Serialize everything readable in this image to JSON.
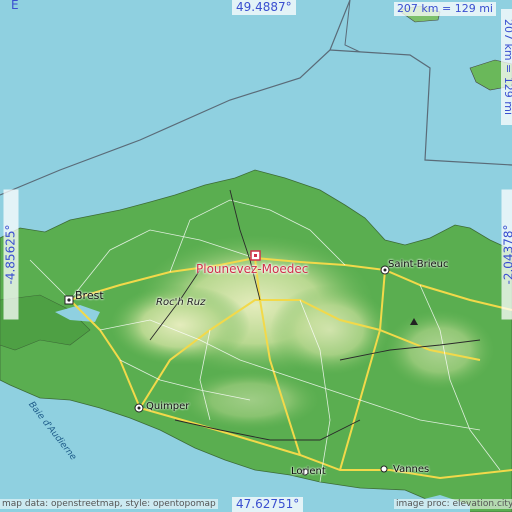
{
  "map": {
    "place_name": "Plounevez-Moedec",
    "coordinates": {
      "top_latitude": "49.4887°",
      "bottom_latitude": "47.62751°",
      "left_longitude": "-4.85625°",
      "right_longitude": "-2.04378°"
    },
    "scale": {
      "horizontal": "207 km = 129 mi",
      "vertical": "207 km = 129 mi"
    },
    "compass_label": "E",
    "places": {
      "brest": "Brest",
      "quimper": "Quimper",
      "saint_brieuc": "Saint-Brieuc",
      "lorient": "Lorient",
      "vannes": "Vannes",
      "roc_h_ruz": "Roc'h Ruz",
      "bay": "Baie d'Audierne"
    },
    "credits": {
      "left": "map data: openstreetmap, style: opentopomap",
      "right": "image proc: elevation.city"
    },
    "colors": {
      "sea": "#8fd0e0",
      "lowland": "#4fa84a",
      "upland": "#dce8b0",
      "marker": "#d0304a",
      "coordinate_text": "#3a4fd0"
    }
  }
}
